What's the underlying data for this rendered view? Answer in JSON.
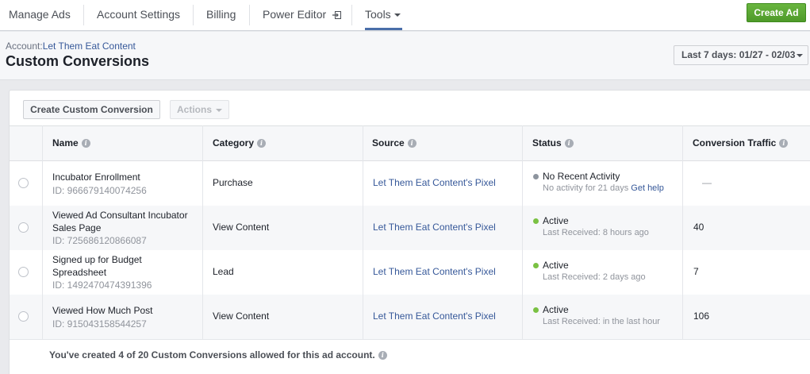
{
  "nav": {
    "items": [
      {
        "label": "Manage Ads"
      },
      {
        "label": "Account Settings"
      },
      {
        "label": "Billing"
      },
      {
        "label": "Power Editor"
      },
      {
        "label": "Tools"
      }
    ],
    "create_ad_label": "Create Ad"
  },
  "header": {
    "account_prefix": "Account:",
    "account_name": "Let Them Eat Content",
    "title": "Custom Conversions",
    "date_range": "Last 7 days: 01/27 - 02/03"
  },
  "toolbar": {
    "create_label": "Create Custom Conversion",
    "actions_label": "Actions"
  },
  "table": {
    "columns": [
      "Name",
      "Category",
      "Source",
      "Status",
      "Conversion Traffic"
    ],
    "rows": [
      {
        "name_lines": [
          "Incubator Enrollment"
        ],
        "id": "ID: 966679140074256",
        "category": "Purchase",
        "source": "Let Them Eat Content's Pixel",
        "status": "No Recent Activity",
        "status_detail": "No activity for 21 days",
        "status_link": "Get help",
        "status_color": "#8d949e",
        "traffic": "—"
      },
      {
        "name_lines": [
          "Viewed Ad Consultant Incubator",
          "Sales Page"
        ],
        "id": "ID: 725686120866087",
        "category": "View Content",
        "source": "Let Them Eat Content's Pixel",
        "status": "Active",
        "status_detail": "Last Received: 8 hours ago",
        "status_color": "#7ac143",
        "traffic": "40"
      },
      {
        "name_lines": [
          "Signed up for Budget",
          "Spreadsheet"
        ],
        "id": "ID: 1492470474391396",
        "category": "Lead",
        "source": "Let Them Eat Content's Pixel",
        "status": "Active",
        "status_detail": "Last Received: 2 days ago",
        "status_color": "#7ac143",
        "traffic": "7"
      },
      {
        "name_lines": [
          "Viewed How Much Post"
        ],
        "id": "ID: 915043158544257",
        "category": "View Content",
        "source": "Let Them Eat Content's Pixel",
        "status": "Active",
        "status_detail": "Last Received: in the last hour",
        "status_color": "#7ac143",
        "traffic": "106"
      }
    ]
  },
  "footer": {
    "text": "You've created 4 of 20 Custom Conversions allowed for this ad account."
  },
  "colors": {
    "accent": "#4a6ea9",
    "link": "#365899",
    "create_button": "#5ba636",
    "active_green": "#7ac143"
  }
}
